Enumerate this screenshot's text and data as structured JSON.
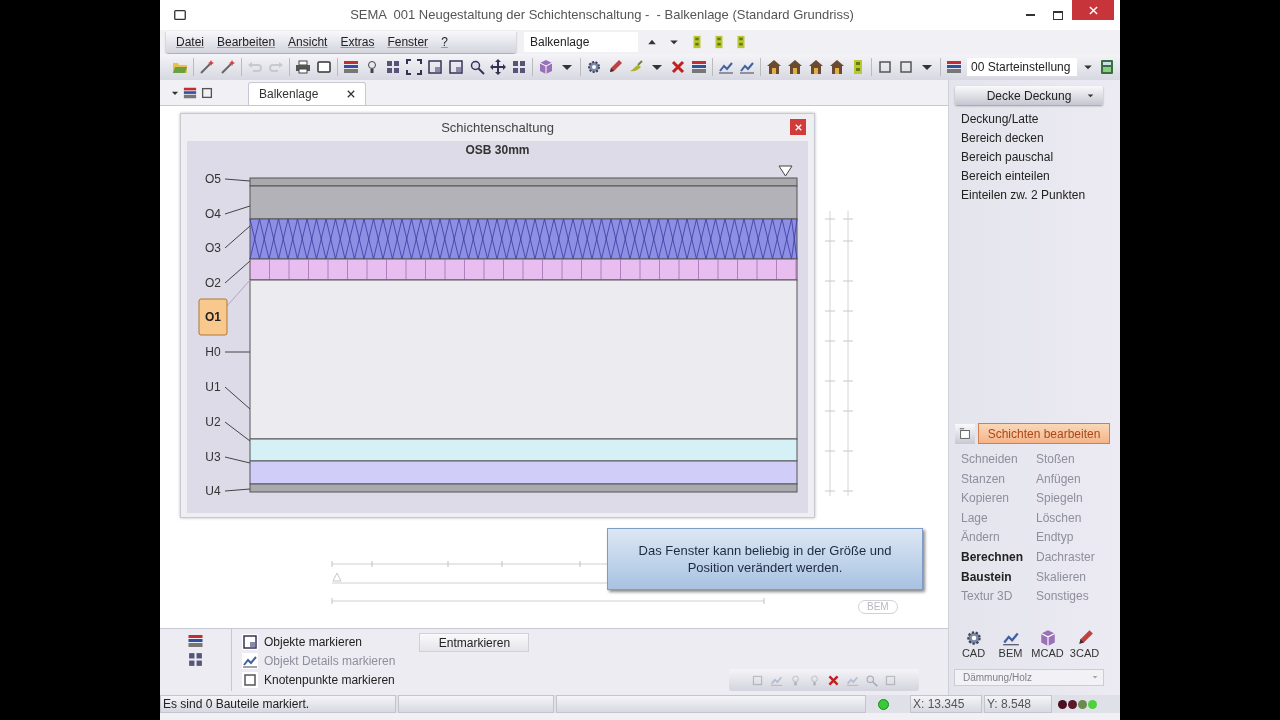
{
  "window": {
    "title": "SEMA  001 Neugestaltung der Schichtenschaltung -  - Balkenlage (Standard Grundriss)"
  },
  "menu": [
    "Datei",
    "Bearbeiten",
    "Ansicht",
    "Extras",
    "Fenster",
    "?"
  ],
  "view_selector": {
    "value": "Balkenlage"
  },
  "preset_selector": {
    "value": "00 Starteinstellung"
  },
  "tabs": [
    {
      "label": "Balkenlage",
      "selected": true
    }
  ],
  "dialog": {
    "title": "Schichtenschaltung",
    "heading": "OSB 30mm",
    "layer_labels": [
      {
        "label": "O5",
        "selected": false
      },
      {
        "label": "O4",
        "selected": false
      },
      {
        "label": "O3",
        "selected": false
      },
      {
        "label": "O2",
        "selected": false
      },
      {
        "label": "O1",
        "selected": true
      },
      {
        "label": "H0",
        "selected": false
      },
      {
        "label": "U1",
        "selected": false
      },
      {
        "label": "U2",
        "selected": false
      },
      {
        "label": "U3",
        "selected": false
      },
      {
        "label": "U4",
        "selected": false
      }
    ],
    "layers": [
      {
        "kind": "solid",
        "color": "#a9a9ae"
      },
      {
        "kind": "solid",
        "color": "#b2b2b8"
      },
      {
        "kind": "insulation",
        "color": "#8d8fe4"
      },
      {
        "kind": "cells",
        "color": "#e8bdf0"
      },
      {
        "kind": "solid",
        "color": "#ececf0"
      },
      {
        "kind": "solid",
        "color": "#d6f1f5"
      },
      {
        "kind": "solid",
        "color": "#d0cef8"
      },
      {
        "kind": "solid",
        "color": "#a9a9ae"
      }
    ]
  },
  "tooltip": "Das Fenster kann beliebig in der Größe und Position verändert werden.",
  "canvas_badge": "BEM",
  "panel": {
    "dropdown": "Decke Deckung",
    "items": [
      "Deckung/Latte",
      "Bereich decken",
      "Bereich pauschal",
      "Bereich einteilen",
      "Einteilen zw. 2 Punkten"
    ],
    "action_button": "Schichten bearbeiten",
    "commands": [
      {
        "label": "Schneiden",
        "disabled": true
      },
      {
        "label": "Stoßen",
        "disabled": true
      },
      {
        "label": "Stanzen",
        "disabled": true
      },
      {
        "label": "Anfügen",
        "disabled": true
      },
      {
        "label": "Kopieren",
        "disabled": true
      },
      {
        "label": "Spiegeln",
        "disabled": true
      },
      {
        "label": "Lage",
        "disabled": true
      },
      {
        "label": "Löschen",
        "disabled": true
      },
      {
        "label": "Ändern",
        "disabled": true
      },
      {
        "label": "Endtyp",
        "disabled": true
      },
      {
        "label": "Berechnen",
        "disabled": false
      },
      {
        "label": "Dachraster",
        "disabled": true
      },
      {
        "label": "Baustein",
        "disabled": false
      },
      {
        "label": "Skalieren",
        "disabled": true
      },
      {
        "label": "Textur 3D",
        "disabled": true
      },
      {
        "label": "Sonstiges",
        "disabled": true
      }
    ],
    "modes": [
      "CAD",
      "BEM",
      "MCAD",
      "3CAD"
    ],
    "material_selector": {
      "value": "Dämmung/Holz",
      "disabled": true
    }
  },
  "marking": {
    "options": [
      {
        "label": "Objekte markieren",
        "disabled": false
      },
      {
        "label": "Objekt Details markieren",
        "disabled": true
      },
      {
        "label": "Knotenpunkte markieren",
        "disabled": false
      }
    ],
    "button": "Entmarkieren"
  },
  "status_bar": {
    "message": "Es sind 0 Bauteile markiert.",
    "x": "X: 13.345",
    "y": "Y: 8.548"
  }
}
